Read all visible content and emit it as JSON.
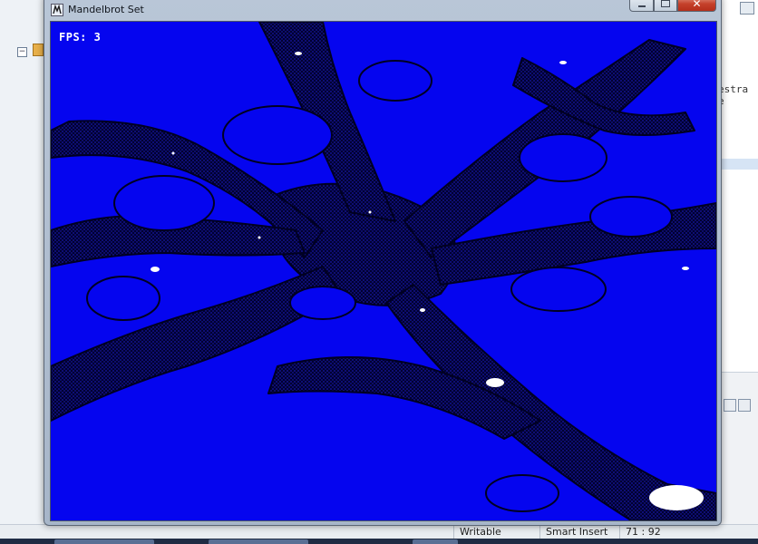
{
  "window": {
    "title": "Mandelbrot Set",
    "controls": {
      "minimize": "minimize",
      "maximize": "maximize",
      "close": "close"
    }
  },
  "overlay": {
    "fps_label": "FPS:",
    "fps_value": "3"
  },
  "fractal": {
    "background_color": "#0505ef",
    "filament_color": "#000033",
    "detail_color": "#1a1ab4",
    "interior_color": "#ffffff"
  },
  "ide_background": {
    "code_fragment": "estra e",
    "collapse_glyph": "−"
  },
  "status_bar": {
    "mode": "Writable",
    "insert_mode": "Smart Insert",
    "position": "71 : 92"
  },
  "icons": {
    "app": "java-window-icon",
    "close": "close-x-icon"
  }
}
